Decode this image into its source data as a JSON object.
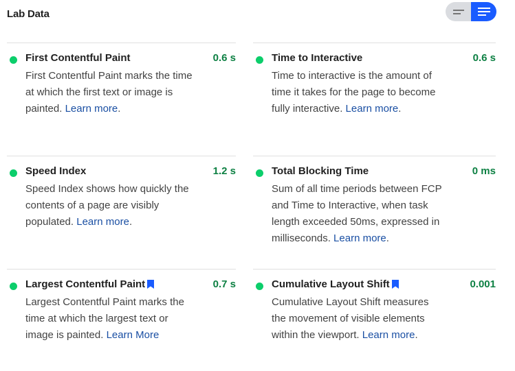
{
  "header": {
    "title": "Lab Data",
    "view_toggle": {
      "options": [
        {
          "name": "compact-view",
          "icon": "short-lines-icon",
          "selected": false
        },
        {
          "name": "expanded-view",
          "icon": "long-lines-icon",
          "selected": true
        }
      ]
    }
  },
  "colors": {
    "pass": "#0cce6b",
    "value_text": "#0d8043",
    "link": "#1a4fa3",
    "accent": "#1a5cff"
  },
  "metrics": [
    {
      "title": "First Contentful Paint",
      "value": "0.6 s",
      "status": "pass",
      "bookmark": false,
      "description": "First Contentful Paint marks the time at which the first text or image is painted.",
      "link_text": "Learn more",
      "trailing": "."
    },
    {
      "title": "Time to Interactive",
      "value": "0.6 s",
      "status": "pass",
      "bookmark": false,
      "description": "Time to interactive is the amount of time it takes for the page to become fully interactive.",
      "link_text": "Learn more",
      "trailing": "."
    },
    {
      "title": "Speed Index",
      "value": "1.2 s",
      "status": "pass",
      "bookmark": false,
      "description": "Speed Index shows how quickly the contents of a page are visibly populated.",
      "link_text": "Learn more",
      "trailing": "."
    },
    {
      "title": "Total Blocking Time",
      "value": "0 ms",
      "status": "pass",
      "bookmark": false,
      "description": "Sum of all time periods between FCP and Time to Interactive, when task length exceeded 50ms, expressed in milliseconds.",
      "link_text": "Learn more",
      "trailing": "."
    },
    {
      "title": "Largest Contentful Paint",
      "value": "0.7 s",
      "status": "pass",
      "bookmark": true,
      "description": "Largest Contentful Paint marks the time at which the largest text or image is painted.",
      "link_text": "Learn More",
      "trailing": ""
    },
    {
      "title": "Cumulative Layout Shift",
      "value": "0.001",
      "status": "pass",
      "bookmark": true,
      "description": "Cumulative Layout Shift measures the movement of visible elements within the viewport.",
      "link_text": "Learn more",
      "trailing": "."
    }
  ]
}
